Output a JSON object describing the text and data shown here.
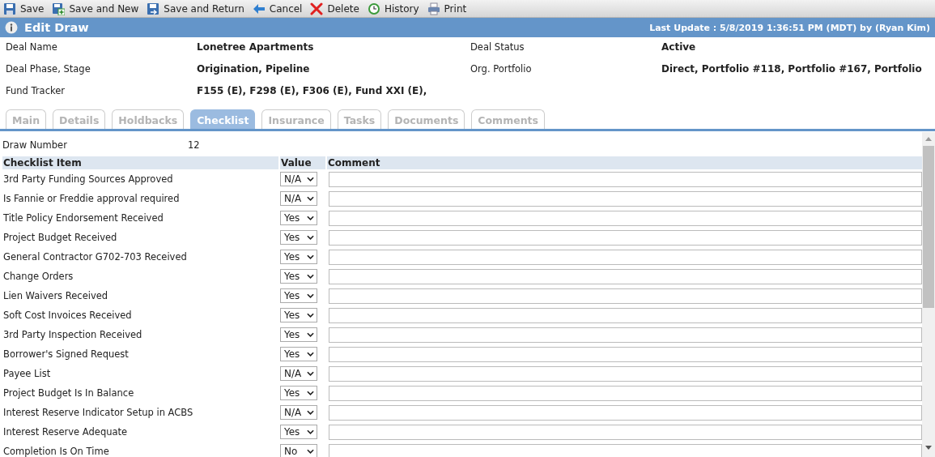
{
  "toolbar": [
    {
      "label": "Save"
    },
    {
      "label": "Save and New"
    },
    {
      "label": "Save and Return"
    },
    {
      "label": "Cancel"
    },
    {
      "label": "Delete"
    },
    {
      "label": "History"
    },
    {
      "label": "Print"
    }
  ],
  "header": {
    "title": "Edit Draw",
    "last_update": "Last Update : 5/8/2019 1:36:51 PM (MDT) by (Ryan Kim)"
  },
  "fields": [
    {
      "label": "Deal Name",
      "value": "Lonetree Apartments"
    },
    {
      "label": "Deal Status",
      "value": "Active"
    },
    {
      "label": "Deal Phase, Stage",
      "value": "Origination, Pipeline"
    },
    {
      "label": "Org. Portfolio",
      "value": "Direct, Portfolio #118, Portfolio #167, Portfolio"
    },
    {
      "label": "Fund Tracker",
      "value": "F155 (E), F298 (E), F306 (E), Fund XXI (E),"
    }
  ],
  "tabs": [
    {
      "label": "Main",
      "selected": false
    },
    {
      "label": "Details",
      "selected": false
    },
    {
      "label": "Holdbacks",
      "selected": false
    },
    {
      "label": "Checklist",
      "selected": true
    },
    {
      "label": "Insurance",
      "selected": false
    },
    {
      "label": "Tasks",
      "selected": false
    },
    {
      "label": "Documents",
      "selected": false
    },
    {
      "label": "Comments",
      "selected": false
    }
  ],
  "draw_number": {
    "label": "Draw Number",
    "value": "12"
  },
  "table": {
    "columns": [
      "Checklist Item",
      "Value",
      "Comment"
    ],
    "rows": [
      {
        "item": "3rd Party Funding Sources Approved",
        "value": "N/A"
      },
      {
        "item": "Is Fannie or Freddie approval required",
        "value": "N/A"
      },
      {
        "item": "Title Policy Endorsement Received",
        "value": "Yes"
      },
      {
        "item": "Project Budget Received",
        "value": "Yes"
      },
      {
        "item": "General Contractor G702-703 Received",
        "value": "Yes"
      },
      {
        "item": "Change Orders",
        "value": "Yes"
      },
      {
        "item": "Lien Waivers Received",
        "value": "Yes"
      },
      {
        "item": "Soft Cost Invoices Received",
        "value": "Yes"
      },
      {
        "item": "3rd Party Inspection Received",
        "value": "Yes"
      },
      {
        "item": "Borrower's Signed Request",
        "value": "Yes"
      },
      {
        "item": "Payee List",
        "value": "N/A"
      },
      {
        "item": "Project Budget Is In Balance",
        "value": "Yes"
      },
      {
        "item": "Interest Reserve Indicator Setup in ACBS",
        "value": "N/A"
      },
      {
        "item": "Interest Reserve Adequate",
        "value": "Yes"
      },
      {
        "item": "Completion Is On Time",
        "value": "No"
      }
    ]
  }
}
